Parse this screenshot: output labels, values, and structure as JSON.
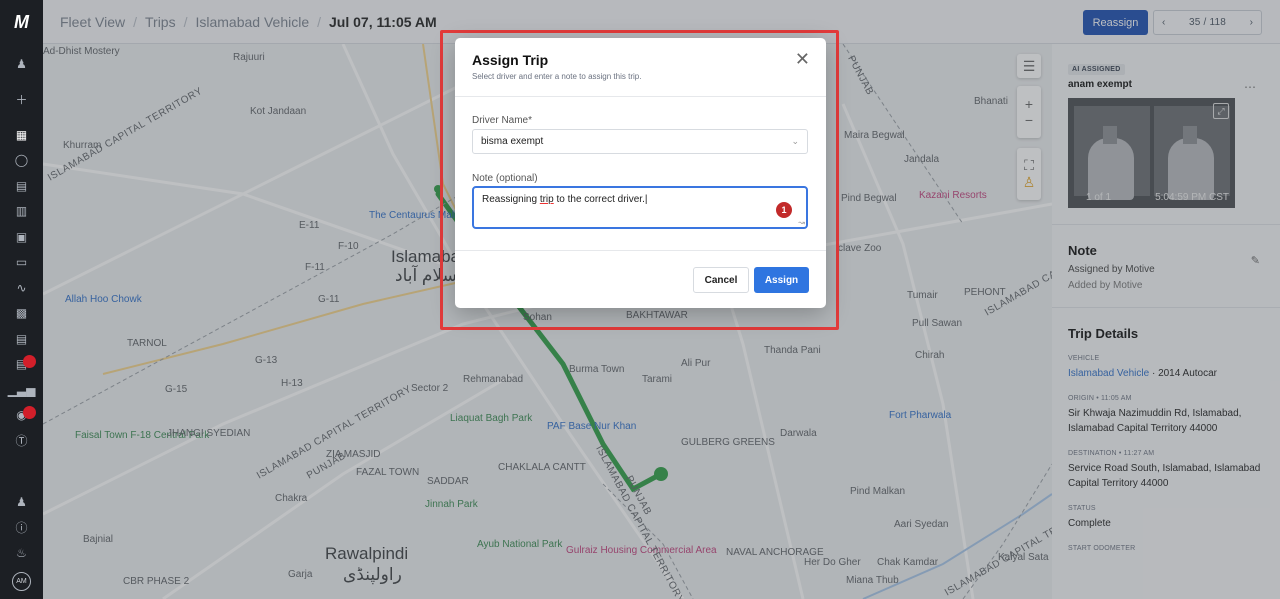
{
  "nav": {
    "logo": "M",
    "items": [
      "users-icon",
      "plus-icon",
      "map-icon",
      "shield-icon",
      "document-icon",
      "fuel-icon",
      "vehicle-icon",
      "card-icon",
      "route-icon",
      "copy-icon",
      "report-icon",
      "alerts-icon",
      "chart-icon",
      "settings-icon",
      "dollar-icon"
    ],
    "bottom_items": [
      "user-settings-icon",
      "help-icon",
      "bell-icon"
    ],
    "avatar": "AM"
  },
  "topbar": {
    "breadcrumbs": [
      "Fleet View",
      "Trips",
      "Islamabad Vehicle"
    ],
    "current": "Jul 07, 11:05 AM",
    "reassign_label": "Reassign",
    "pager": {
      "current": "35",
      "total": "118",
      "prev": "‹",
      "next": "›"
    }
  },
  "map": {
    "labels": {
      "l1": "Kot Jandaan",
      "l2": "Khurram",
      "l3": "The Centaurus Mall",
      "l4": "E-11",
      "l5": "F-10",
      "l6": "F-11",
      "l7": "G-11",
      "l8": "Islamabad",
      "l9": "اسلام آباد",
      "l10": "Allah Hoo Chowk",
      "l11": "TARNOL",
      "l12": "G-13",
      "l13": "G-15",
      "l14": "H-13",
      "l15": "Sector 2",
      "l16": "Rehmanabad",
      "l17": "Liaquat Bagh Park",
      "l18": "PAF Base Nur Khan",
      "l19": "Faisal Town F-18 Central Park",
      "l20": "JHANGI SYEDIAN",
      "l21": "ZIA MASJID",
      "l22": "FAZAL TOWN",
      "l23": "CHAKLALA CANTT",
      "l24": "SADDAR",
      "l25": "Jinnah Park",
      "l26": "Chakra",
      "l27": "Ayub National Park",
      "l28": "Gulraiz Housing Commercial Area",
      "l29": "Rawalpindi",
      "l30": "راولپنڈی",
      "l31": "Bajnial",
      "l32": "Garja",
      "l33": "Sohan",
      "l34": "Burma Town",
      "l35": "Ali Pur",
      "l36": "Tarami",
      "l37": "BAKHTAWAR",
      "l38": "Thanda Pani",
      "l39": "Maira Begwal",
      "l40": "Bhanati",
      "l41": "Jandala",
      "l42": "Kazani Resorts",
      "l43": "Pind Begwal",
      "l44": "Tumair",
      "l45": "Pull Sawan",
      "l46": "Chirah",
      "l47": "Fort Pharwala",
      "l48": "Darwala",
      "l49": "Pind Malkan",
      "l50": "Aari Syedan",
      "l51": "Her Do Gher",
      "l52": "Chak Kamdar",
      "l53": "Kalyal Sata",
      "l54": "Miana Thub",
      "l55": "GULBERG GREENS",
      "l56": "NAVAL ANCHORAGE",
      "l57": "PEHONT",
      "l58": "ISLAMABAD CAPITAL TERRITORY",
      "l59": "PUNJAB",
      "l60": "ISLAMABAD CAPITAL TERRITORY",
      "l61": "PUNJAB",
      "l62": "ISLAMABAD CAPITAL TERRITORY",
      "l63": "PUNJAB",
      "l64": "Rajuuri",
      "l65": "CBR PHASE 2",
      "l66": "Ad-Dhist Mostery",
      "l67": "ISLAMABAD CAPITAL TERRITORY",
      "l68": "PUNJAB",
      "l69": "ISLAMABAD CAPITAL TERRITORY",
      "l70": "PUNJAB",
      "l71": "clave Zoo"
    }
  },
  "panel": {
    "ai_badge": "AI ASSIGNED",
    "driver": "anam exempt",
    "camera": {
      "count": "1 of 1",
      "time": "5:04:59 PM CST"
    },
    "note_heading": "Note",
    "note_assigned": "Assigned by Motive",
    "note_added": "Added by Motive",
    "trip_heading": "Trip Details",
    "vehicle_label": "VEHICLE",
    "vehicle_link": "Islamabad Vehicle",
    "vehicle_model": "2014 Autocar",
    "origin_label": "ORIGIN • 11:05 AM",
    "origin": "Sir Khwaja Nazimuddin Rd, Islamabad, Islamabad Capital Territory 44000",
    "destination_label": "DESTINATION • 11:27 AM",
    "destination": "Service Road South, Islamabad, Islamabad Capital Territory 44000",
    "status_label": "STATUS",
    "status": "Complete",
    "odometer_label": "START ODOMETER"
  },
  "modal": {
    "title": "Assign Trip",
    "subtitle": "Select driver and enter a note to assign this trip.",
    "driver_label": "Driver Name*",
    "driver_value": "bisma exempt",
    "note_label": "Note (optional)",
    "note_text_pre": "Reassigning ",
    "note_text_underlined": "trip",
    "note_text_post": " to the correct driver.",
    "note_badge": "1",
    "cancel_label": "Cancel",
    "assign_label": "Assign"
  }
}
